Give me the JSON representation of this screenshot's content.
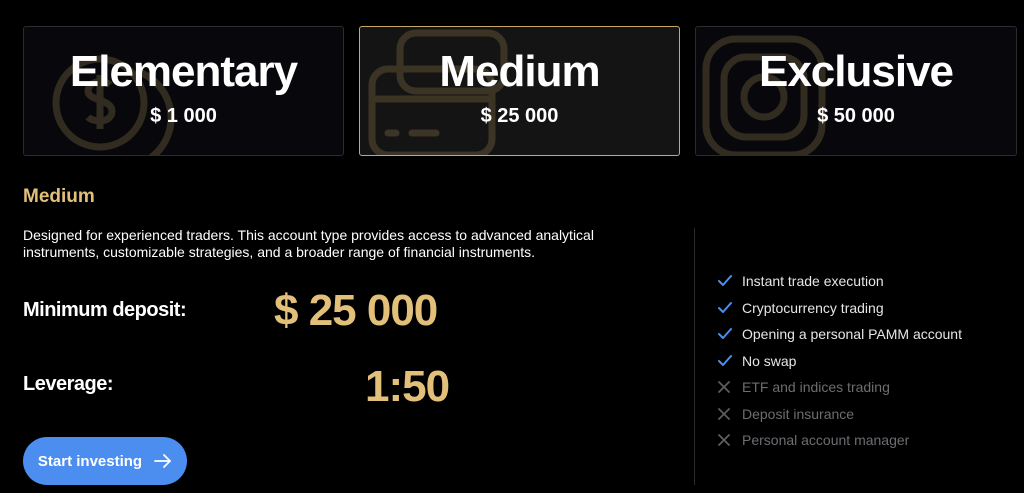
{
  "accent_color": "#e3c07a",
  "button_color": "#4c8ef0",
  "plans": [
    {
      "name": "Elementary",
      "price": "$ 1 000",
      "icon": "dollar-coin-icon",
      "selected": false
    },
    {
      "name": "Medium",
      "price": "$ 25 000",
      "icon": "wallet-card-icon",
      "selected": true
    },
    {
      "name": "Exclusive",
      "price": "$ 50 000",
      "icon": "instagram-icon",
      "selected": false
    }
  ],
  "details": {
    "title": "Medium",
    "description": "Designed for experienced traders. This account type provides access to advanced analytical instruments, customizable strategies, and a broader range of financial instruments.",
    "min_deposit_label": "Minimum deposit:",
    "min_deposit_value": "$ 25 000",
    "leverage_label": "Leverage:",
    "leverage_value": "1:50",
    "cta_label": "Start investing",
    "cta_icon": "arrow-right-icon"
  },
  "features": [
    {
      "label": "Instant trade execution",
      "included": true,
      "icon": "check-icon"
    },
    {
      "label": "Cryptocurrency trading",
      "included": true,
      "icon": "check-icon"
    },
    {
      "label": "Opening a personal PAMM account",
      "included": true,
      "icon": "check-icon"
    },
    {
      "label": "No swap",
      "included": true,
      "icon": "check-icon"
    },
    {
      "label": "ETF and indices trading",
      "included": false,
      "icon": "cross-icon"
    },
    {
      "label": "Deposit insurance",
      "included": false,
      "icon": "cross-icon"
    },
    {
      "label": "Personal account manager",
      "included": false,
      "icon": "cross-icon"
    }
  ]
}
